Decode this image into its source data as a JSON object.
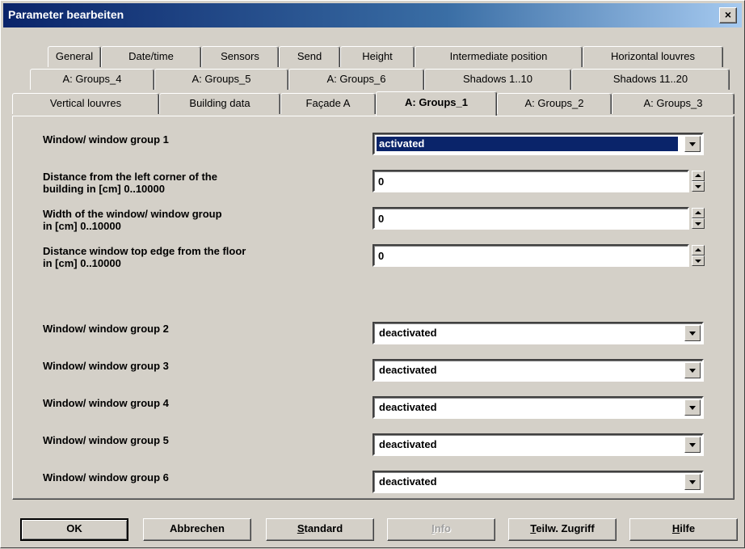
{
  "window": {
    "title": "Parameter bearbeiten",
    "close_label": "×"
  },
  "tabs": {
    "row1": [
      "General",
      "Date/time",
      "Sensors",
      "Send",
      "Height",
      "Intermediate position",
      "Horizontal louvres"
    ],
    "row2": [
      "A: Groups_4",
      "A: Groups_5",
      "A: Groups_6",
      "Shadows 1..10",
      "Shadows 11..20"
    ],
    "row3": [
      "Vertical louvres",
      "Building data",
      "Façade A",
      "A: Groups_1",
      "A: Groups_2",
      "A: Groups_3"
    ],
    "active": "A: Groups_1"
  },
  "params": {
    "group1": {
      "label": "Window/ window group 1",
      "value": "activated"
    },
    "distance_left": {
      "label_line1": "Distance from the left corner of the",
      "label_line2": "building in [cm]   0..10000",
      "value": "0"
    },
    "width": {
      "label_line1": "Width of the window/ window group",
      "label_line2": "in [cm]   0..10000",
      "value": "0"
    },
    "top_edge": {
      "label_line1": "Distance window top edge from the floor",
      "label_line2": "in [cm]   0..10000",
      "value": "0"
    },
    "group2": {
      "label": "Window/ window group 2",
      "value": "deactivated"
    },
    "group3": {
      "label": "Window/ window group 3",
      "value": "deactivated"
    },
    "group4": {
      "label": "Window/ window group 4",
      "value": "deactivated"
    },
    "group5": {
      "label": "Window/ window group 5",
      "value": "deactivated"
    },
    "group6": {
      "label": "Window/ window group 6",
      "value": "deactivated"
    }
  },
  "buttons": {
    "ok": "OK",
    "cancel": "Abbrechen",
    "standard_u": "S",
    "standard_rest": "tandard",
    "info_u": "I",
    "info_rest": "nfo",
    "partial_u": "T",
    "partial_rest": "eilw. Zugriff",
    "help_u": "H",
    "help_rest": "ilfe"
  },
  "colors": {
    "face": "#d4d0c8",
    "title_bar": "#0a246a",
    "selection": "#0a246a"
  }
}
